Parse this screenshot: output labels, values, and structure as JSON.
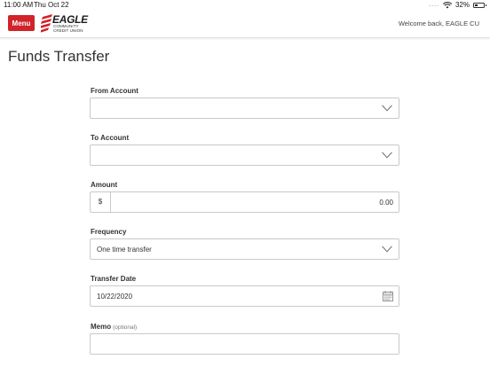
{
  "status_bar": {
    "time": "11:00 AM",
    "date": "Thu Oct 22",
    "signal": "....",
    "battery": "32%",
    "battery_level": 0.32
  },
  "header": {
    "menu_label": "Menu",
    "logo_word": "EAGLE",
    "logo_line1": "COMMUNITY",
    "logo_line2": "CREDIT UNION",
    "welcome": "Welcome back, EAGLE CU"
  },
  "page": {
    "title": "Funds Transfer"
  },
  "form": {
    "from_account": {
      "label": "From Account",
      "value": ""
    },
    "to_account": {
      "label": "To Account",
      "value": ""
    },
    "amount": {
      "label": "Amount",
      "prefix": "$",
      "value": "0.00"
    },
    "frequency": {
      "label": "Frequency",
      "value": "One time transfer"
    },
    "transfer_date": {
      "label": "Transfer Date",
      "value": "10/22/2020"
    },
    "memo": {
      "label": "Memo",
      "optional": "(optional)",
      "value": ""
    }
  },
  "colors": {
    "brand_red": "#d1232a",
    "border": "#c9c9c9"
  }
}
